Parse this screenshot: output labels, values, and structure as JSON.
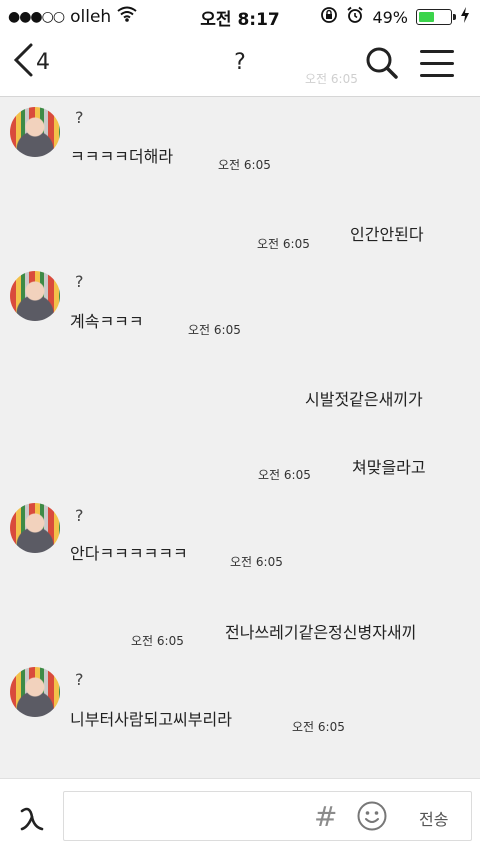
{
  "statusbar": {
    "signal": "●●●○○",
    "carrier": "olleh",
    "time": "오전 8:17",
    "battery": "49%",
    "battery_level": 0.49,
    "icons": [
      "wifi-icon",
      "rotation-lock-icon",
      "alarm-icon",
      "battery-icon",
      "charging-icon"
    ]
  },
  "navbar": {
    "back_count": "4",
    "title": "?",
    "ghost_time": "오전 6:05",
    "icons": [
      "back-chevron-icon",
      "search-icon",
      "menu-icon"
    ]
  },
  "messages": [
    {
      "side": "in",
      "sender": "?",
      "text": "ㅋㅋㅋㅋ더해라",
      "time": "오전 6:05"
    },
    {
      "side": "out",
      "text": "인간안된다",
      "time": "오전 6:05"
    },
    {
      "side": "in",
      "sender": "?",
      "text": "계속ㅋㅋㅋ",
      "time": "오전 6:05"
    },
    {
      "side": "out",
      "text": "시발젓같은새끼가",
      "time": ""
    },
    {
      "side": "out",
      "text": "쳐맞을라고",
      "time": "오전 6:05"
    },
    {
      "side": "in",
      "sender": "?",
      "text": "안다ㅋㅋㅋㅋㅋㅋ",
      "time": "오전 6:05"
    },
    {
      "side": "out",
      "text": "전나쓰레기같은정신병자새끼",
      "time": "오전 6:05"
    },
    {
      "side": "in",
      "sender": "?",
      "text": "니부터사람되고씨부리라",
      "time": "오전 6:05"
    }
  ],
  "inputbar": {
    "hash": "#",
    "send_label": "전송",
    "icons": [
      "emoticon-icon",
      "hashtag-icon",
      "smiley-icon"
    ]
  },
  "colors": {
    "chat_background": "#f0f0f0",
    "battery_fill": "#3bd44b",
    "text": "#222222"
  }
}
